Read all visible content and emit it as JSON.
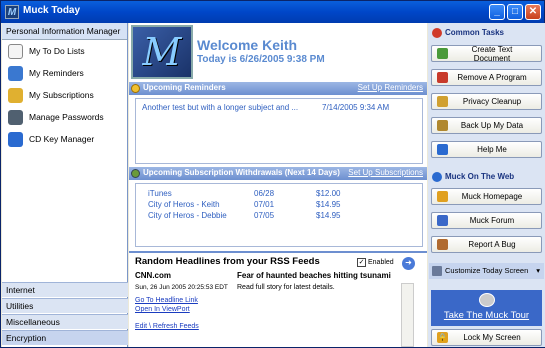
{
  "window": {
    "title": "Muck Today",
    "minimize": "_",
    "maximize": "□",
    "close": "✕"
  },
  "nav": {
    "header": "Personal Information Manager",
    "items": [
      {
        "label": "My To Do Lists",
        "icon": "todo-icon",
        "color": "#f4f4f4"
      },
      {
        "label": "My Reminders",
        "icon": "reminder-clock-icon",
        "color": "#3a78d0"
      },
      {
        "label": "My Subscriptions",
        "icon": "subscriptions-folder-icon",
        "color": "#e0b030"
      },
      {
        "label": "Manage Passwords",
        "icon": "keychain-icon",
        "color": "#506070"
      },
      {
        "label": "CD Key Manager",
        "icon": "globe-icon",
        "color": "#2a6ad0"
      }
    ],
    "bottom": [
      "Internet",
      "Utilities",
      "Miscellaneous",
      "Encryption"
    ]
  },
  "main": {
    "logo_letter": "M",
    "welcome": "Welcome Keith",
    "today": "Today is 6/26/2005 9:38 PM",
    "reminders": {
      "title": "Upcoming Reminders",
      "link": "Set Up Reminders",
      "rows": [
        {
          "text": "Another test but with a longer subject and ...",
          "date": "7/14/2005 9:34 AM"
        }
      ]
    },
    "subscriptions": {
      "title": "Upcoming Subscription Withdrawals (Next 14 Days)",
      "link": "Set Up Subscriptions",
      "rows": [
        {
          "name": "iTunes",
          "date": "06/28",
          "amount": "$12.00"
        },
        {
          "name": "City of Heros - Keith",
          "date": "07/01",
          "amount": "$14.95"
        },
        {
          "name": "City of Heros - Debbie",
          "date": "07/05",
          "amount": "$14.95"
        }
      ]
    },
    "rss": {
      "title": "Random Headlines from your RSS Feeds",
      "enabled_label": "Enabled",
      "source": "CNN.com",
      "date": "Sun, 26 Jun 2005 20:25:53 EDT",
      "goto_link": "Go To Headline Link",
      "open_link": "Open In ViewPort",
      "edit_link": "Edit \\ Refresh Feeds",
      "headline": "Fear of haunted beaches hitting tsunami",
      "detail": "Read full story for latest details."
    }
  },
  "right": {
    "common_title": "Common Tasks",
    "common_tasks": [
      {
        "label": "Create Text Document",
        "icon": "text-document-icon",
        "color": "#4a9a3a"
      },
      {
        "label": "Remove A Program",
        "icon": "remove-program-icon",
        "color": "#c83a2a"
      },
      {
        "label": "Privacy Cleanup",
        "icon": "broom-icon",
        "color": "#d0a030"
      },
      {
        "label": "Back Up My Data",
        "icon": "backup-icon",
        "color": "#b08830"
      },
      {
        "label": "Help Me",
        "icon": "help-icon",
        "color": "#2a6ad0"
      }
    ],
    "web_title": "Muck On The Web",
    "web_links": [
      {
        "label": "Muck Homepage",
        "icon": "star-icon",
        "color": "#e0a020"
      },
      {
        "label": "Muck Forum",
        "icon": "forum-icon",
        "color": "#3a68c8"
      },
      {
        "label": "Report A Bug",
        "icon": "bug-icon",
        "color": "#b06a30"
      }
    ],
    "customize_label": "Customize Today Screen",
    "promo": "Take The Muck Tour",
    "lock": "Lock My Screen"
  }
}
